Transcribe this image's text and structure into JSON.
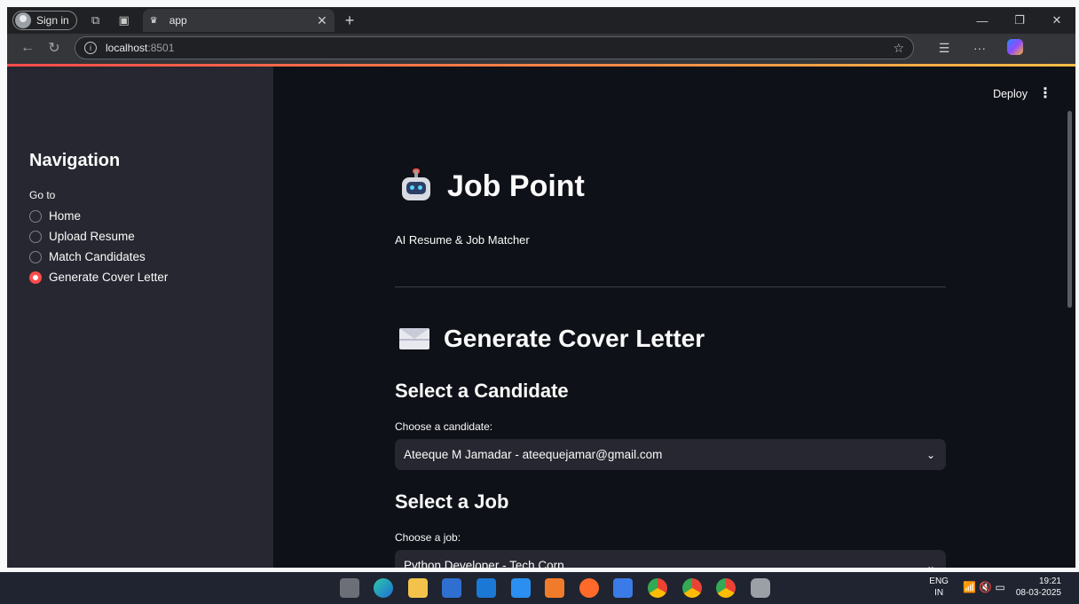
{
  "browser": {
    "sign_in": "Sign in",
    "tab_title": "app",
    "url_host": "localhost",
    "url_port": ":8501"
  },
  "sidebar": {
    "title": "Navigation",
    "goto_label": "Go to",
    "items": [
      {
        "label": "Home",
        "selected": false
      },
      {
        "label": "Upload Resume",
        "selected": false
      },
      {
        "label": "Match Candidates",
        "selected": false
      },
      {
        "label": "Generate Cover Letter",
        "selected": true
      }
    ]
  },
  "header": {
    "deploy_label": "Deploy"
  },
  "main": {
    "app_title": "Job Point",
    "subtitle": "AI Resume & Job Matcher",
    "section_title": "Generate Cover Letter",
    "candidate": {
      "heading": "Select a Candidate",
      "label": "Choose a candidate:",
      "value": "Ateeque M Jamadar - ateequejamar@gmail.com"
    },
    "job": {
      "heading": "Select a Job",
      "label": "Choose a job:",
      "value": "Python Developer - Tech Corp"
    }
  },
  "taskbar": {
    "lang_line1": "ENG",
    "lang_line2": "IN",
    "time": "19:21",
    "date": "08-03-2025"
  },
  "colors": {
    "accent": "#ff4b4b",
    "app_bg": "#0e1117",
    "sidebar_bg": "#262730"
  }
}
